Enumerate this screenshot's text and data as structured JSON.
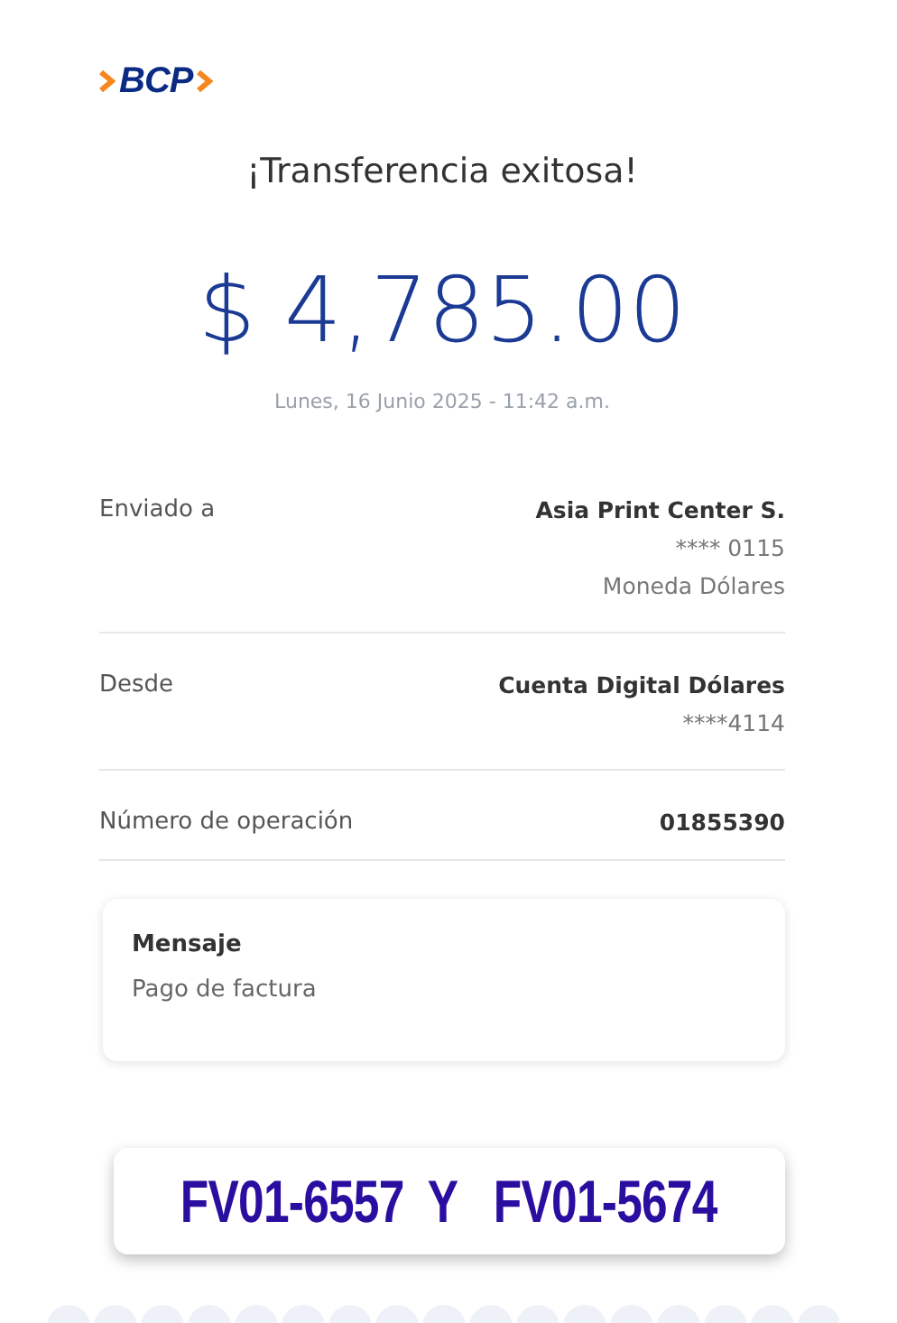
{
  "logo": {
    "text": "BCP"
  },
  "title": "¡Transferencia exitosa!",
  "amount": "$ 4,785.00",
  "datetime": "Lunes, 16 Junio 2025 - 11:42 a.m.",
  "details": [
    {
      "label": "Enviado a",
      "values": [
        {
          "kind": "strong",
          "text": "Asia Print Center S."
        },
        {
          "kind": "plain",
          "text": "**** 0115"
        },
        {
          "kind": "plain",
          "text": "Moneda Dólares"
        }
      ]
    },
    {
      "label": "Desde",
      "values": [
        {
          "kind": "strong",
          "text": "Cuenta Digital Dólares"
        },
        {
          "kind": "plain",
          "text": "****4114"
        }
      ]
    },
    {
      "label": "Número de operación",
      "values": [
        {
          "kind": "strong",
          "text": "01855390"
        }
      ]
    }
  ],
  "message": {
    "title": "Mensaje",
    "text": "Pago de factura"
  },
  "overlay_note": "FV01-6557  Y   FV01-5674"
}
